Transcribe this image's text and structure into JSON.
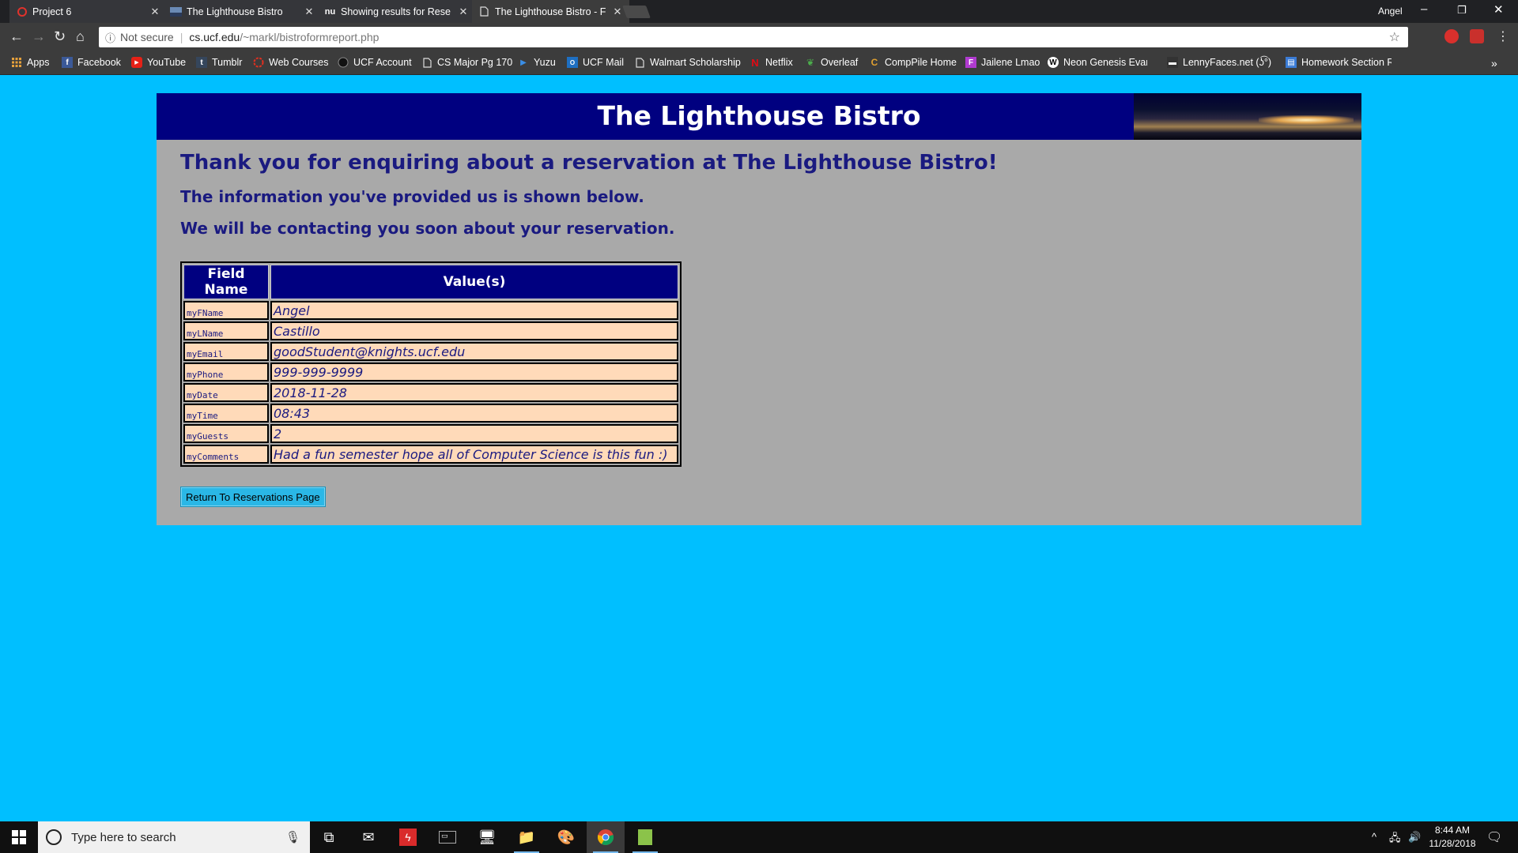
{
  "browser": {
    "tabs": [
      {
        "label": "Project 6",
        "favicon": "o"
      },
      {
        "label": "The Lighthouse Bistro",
        "favicon": "img"
      },
      {
        "label": "Showing results for Rese",
        "favicon": "nu"
      },
      {
        "label": "The Lighthouse Bistro - F",
        "favicon": "doc"
      }
    ],
    "profile_name": "Angel",
    "address": {
      "security": "Not secure",
      "host": "cs.ucf.edu",
      "path": "/~markl/bistroformreport.php"
    },
    "bookmarks": [
      "Apps",
      "Facebook",
      "YouTube",
      "Tumblr",
      "Web Courses",
      "UCF Account",
      "CS Major Pg 170",
      "Yuzu",
      "UCF Mail",
      "Walmart Scholarship",
      "Netflix",
      "Overleaf",
      "CompPile Home",
      "Jailene Lmao",
      "Neon Genesis Evange",
      "LennyFaces.net (ʖ͡°)",
      "Homework Section R"
    ]
  },
  "page": {
    "banner_title": "The Lighthouse Bistro",
    "heading": "Thank you for enquiring about a reservation at The Lighthouse Bistro!",
    "subheading1": "The information you've provided us is shown below.",
    "subheading2": "We will be contacting you soon about your reservation.",
    "table": {
      "headers": [
        "Field Name",
        "Value(s)"
      ],
      "rows": [
        {
          "field": "myFName",
          "value": "Angel"
        },
        {
          "field": "myLName",
          "value": "Castillo"
        },
        {
          "field": "myEmail",
          "value": "goodStudent@knights.ucf.edu"
        },
        {
          "field": "myPhone",
          "value": "999-999-9999"
        },
        {
          "field": "myDate",
          "value": "2018-11-28"
        },
        {
          "field": "myTime",
          "value": "08:43"
        },
        {
          "field": "myGuests",
          "value": "2"
        },
        {
          "field": "myComments",
          "value": "Had a fun semester hope all of Computer Science is this fun :)"
        }
      ]
    },
    "return_button": "Return To Reservations Page"
  },
  "taskbar": {
    "search_placeholder": "Type here to search",
    "time": "8:44 AM",
    "date": "11/28/2018"
  },
  "colors": {
    "page_background": "#00bfff",
    "container": "#a9a9a9",
    "banner": "#000080",
    "cell": "#ffdab9",
    "heading_text": "#1a1a80"
  }
}
